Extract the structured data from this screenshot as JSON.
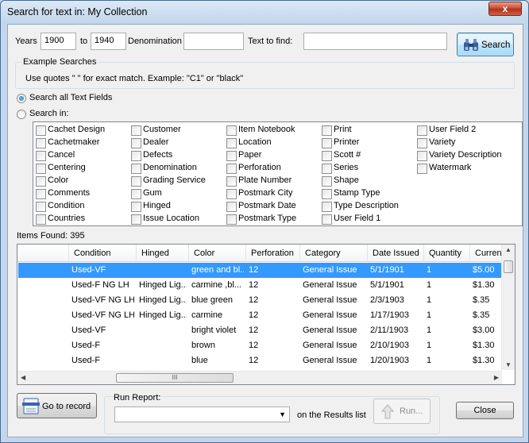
{
  "window": {
    "title": "Search for text in: My Collection",
    "close_glyph": "x"
  },
  "search_row": {
    "years_label": "Years",
    "year_from": "1900",
    "to_label": "to",
    "year_to": "1940",
    "denomination_label": "Denomination",
    "denomination_value": "",
    "text_to_find_label": "Text to find:",
    "text_to_find_value": "",
    "search_button": "Search"
  },
  "examples": {
    "title": "Example Searches",
    "text": "Use quotes \" \" for exact match.  Example: \"C1\" or \"black\""
  },
  "scope": {
    "all_label": "Search all Text Fields",
    "in_label": "Search in:",
    "selected": "all"
  },
  "fields": {
    "col1": [
      "Cachet Design",
      "Cachetmaker",
      "Cancel",
      "Centering",
      "Color",
      "Comments",
      "Condition",
      "Countries"
    ],
    "col2": [
      "Customer",
      "Dealer",
      "Defects",
      "Denomination",
      "Grading Service",
      "Gum",
      "Hinged",
      "Issue Location"
    ],
    "col3": [
      "Item Notebook",
      "Location",
      "Paper",
      "Perforation",
      "Plate Number",
      "Postmark City",
      "Postmark Date",
      "Postmark Type"
    ],
    "col4": [
      "Print",
      "Printer",
      "Scott #",
      "Series",
      "Shape",
      "Stamp Type",
      "Type Description",
      "User Field 1"
    ],
    "col5": [
      "User Field 2",
      "Variety",
      "Variety Description",
      "Watermark"
    ]
  },
  "results": {
    "items_found": "Items Found: 395",
    "columns": [
      "Condition",
      "Hinged",
      "Color",
      "Perforation",
      "Category",
      "Date Issued",
      "Quantity",
      "Current"
    ],
    "rows": [
      [
        "Used-VF",
        "",
        "green and bl...",
        "12",
        "General Issue",
        "5/1/1901",
        "1",
        "$5.00"
      ],
      [
        "Used-F NG LH",
        "Hinged Lig...",
        "carmine ,bl...",
        "12",
        "General Issue",
        "5/1/1901",
        "1",
        "$1.30"
      ],
      [
        "Used-VF NG LH",
        "Hinged Lig...",
        "blue green",
        "12",
        "General Issue",
        "2/3/1903",
        "1",
        "$.35"
      ],
      [
        "Used-VF NG LH",
        "Hinged Lig...",
        "carmine",
        "12",
        "General Issue",
        "1/17/1903",
        "1",
        "$.35"
      ],
      [
        "Used-VF",
        "",
        "bright violet",
        "12",
        "General Issue",
        "2/11/1903",
        "1",
        "$3.00"
      ],
      [
        "Used-F",
        "",
        "brown",
        "12",
        "General Issue",
        "2/10/1903",
        "1",
        "$1.30"
      ],
      [
        "Used-F",
        "",
        "blue",
        "12",
        "General Issue",
        "1/20/1903",
        "1",
        "$1.30"
      ]
    ],
    "selected_row": 0,
    "hscroll_grip": "III"
  },
  "footer": {
    "goto_button": "Go to record",
    "run_report_label": "Run Report:",
    "run_report_value": "",
    "on_results_label": "on the Results list",
    "run_button": "Run...",
    "close_button": "Close"
  }
}
